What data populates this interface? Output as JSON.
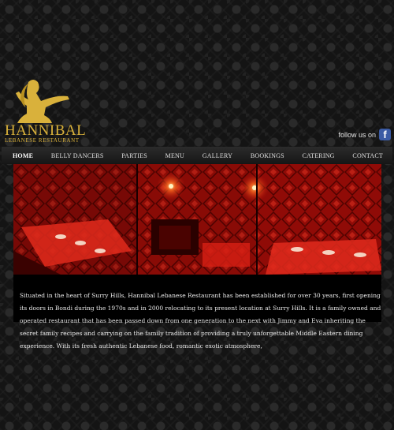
{
  "brand": {
    "name": "HANNIBAL",
    "subtitle": "LEBANESE RESTAURANT",
    "color": "#d9b13b"
  },
  "social": {
    "label": "follow us on",
    "facebook_icon": "facebook-icon",
    "facebook_glyph": "f"
  },
  "nav": {
    "items": [
      {
        "label": "HOME",
        "active": true
      },
      {
        "label": "BELLY DANCERS"
      },
      {
        "label": "PARTIES"
      },
      {
        "label": "MENU"
      },
      {
        "label": "GALLERY"
      },
      {
        "label": "BOOKINGS"
      },
      {
        "label": "CATERING"
      },
      {
        "label": "CONTACT"
      }
    ]
  },
  "intro": {
    "text": "Situated in the heart of Surry Hills, Hannibal Lebanese Restaurant has been established for over 30 years, first opening its doors in Bondi during the 1970s and in 2000 relocating to its present location at Surry Hills. It is a family owned and operated restaurant that has been passed down from one generation to the next with Jimmy and Eva inheriting the secret family recipes and carrying on the family tradition of providing a truly unforgettable Middle Eastern dining experience. With its fresh authentic Lebanese food, romantic exotic atmosphere,"
  },
  "colors": {
    "accent_red": "#c0120c",
    "nav_bg": "#1f1f1f"
  }
}
